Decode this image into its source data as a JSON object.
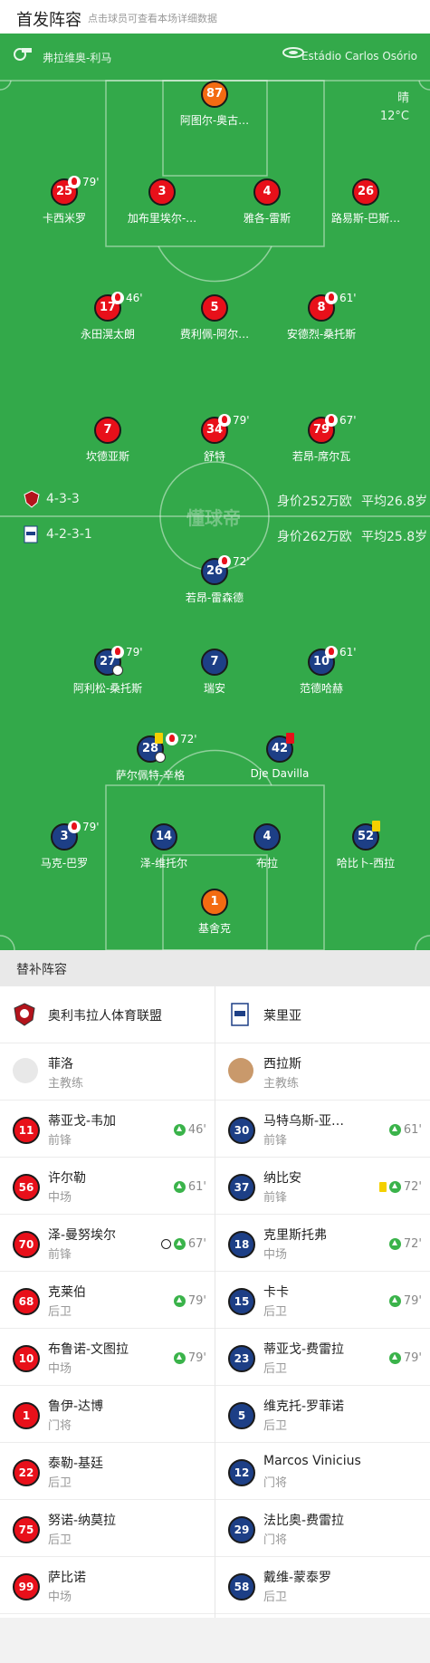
{
  "header": {
    "title": "首发阵容",
    "subtitle": "点击球员可查看本场详细数据"
  },
  "pitch": {
    "referee": "弗拉维奥-利马",
    "stadium": "Estádio Carlos Osório",
    "weather": "晴",
    "temperature": "12°C",
    "brand": "懂球帝",
    "home": {
      "formation": "4-3-3",
      "value": "身价252万欧",
      "age": "平均26.8岁"
    },
    "away": {
      "formation": "4-2-3-1",
      "value": "身价262万欧",
      "age": "平均25.8岁"
    },
    "home_players": [
      {
        "num": "87",
        "name": "阿图尔-奥古…",
        "color": "#f36b12",
        "events": []
      },
      {
        "num": "25",
        "name": "卡西米罗",
        "color": "#e8101a",
        "events": [
          "sub_out"
        ],
        "minute": "79'"
      },
      {
        "num": "3",
        "name": "加布里埃尔-…",
        "color": "#e8101a",
        "events": []
      },
      {
        "num": "4",
        "name": "雅各-雷斯",
        "color": "#e8101a",
        "events": []
      },
      {
        "num": "26",
        "name": "路易斯-巴斯…",
        "color": "#e8101a",
        "events": []
      },
      {
        "num": "17",
        "name": "永田滉太朗",
        "color": "#e8101a",
        "events": [
          "sub_out"
        ],
        "minute": "46'"
      },
      {
        "num": "5",
        "name": "费利佩-阿尔…",
        "color": "#e8101a",
        "events": []
      },
      {
        "num": "8",
        "name": "安德烈-桑托斯",
        "color": "#e8101a",
        "events": [
          "sub_out"
        ],
        "minute": "61'"
      },
      {
        "num": "7",
        "name": "坎德亚斯",
        "color": "#e8101a",
        "events": []
      },
      {
        "num": "34",
        "name": "舒特",
        "color": "#e8101a",
        "events": [
          "sub_out"
        ],
        "minute": "79'"
      },
      {
        "num": "79",
        "name": "若昂-席尔瓦",
        "color": "#e8101a",
        "events": [
          "sub_out"
        ],
        "minute": "67'"
      }
    ],
    "away_players": [
      {
        "num": "26",
        "name": "若昂-雷森德",
        "color": "#1d3f86",
        "events": [
          "sub_out"
        ],
        "minute": "72'"
      },
      {
        "num": "27",
        "name": "阿利松-桑托斯",
        "color": "#1d3f86",
        "events": [
          "sub_out",
          "goal"
        ],
        "minute": "79'"
      },
      {
        "num": "7",
        "name": "瑞安",
        "color": "#1d3f86",
        "events": []
      },
      {
        "num": "10",
        "name": "范德哈赫",
        "color": "#1d3f86",
        "events": [
          "sub_out"
        ],
        "minute": "61'"
      },
      {
        "num": "28",
        "name": "萨尔佩特-辛格",
        "color": "#1d3f86",
        "events": [
          "yellow",
          "sub_out",
          "goal"
        ],
        "minute": "72'"
      },
      {
        "num": "42",
        "name": "Dje Davilla",
        "color": "#1d3f86",
        "events": [
          "red"
        ]
      },
      {
        "num": "3",
        "name": "马克-巴罗",
        "color": "#1d3f86",
        "events": [
          "sub_out"
        ],
        "minute": "79'"
      },
      {
        "num": "14",
        "name": "泽-维托尔",
        "color": "#1d3f86",
        "events": []
      },
      {
        "num": "4",
        "name": "布拉",
        "color": "#1d3f86",
        "events": []
      },
      {
        "num": "52",
        "name": "哈比卜-西拉",
        "color": "#1d3f86",
        "events": [
          "yellow"
        ]
      },
      {
        "num": "1",
        "name": "基舍克",
        "color": "#f36b12",
        "events": []
      }
    ]
  },
  "subs": {
    "title": "替补阵容",
    "home": {
      "team": "奥利韦拉人体育联盟",
      "coach": {
        "name": "菲洛",
        "role": "主教练"
      },
      "players": [
        {
          "num": "11",
          "name": "蒂亚戈-韦加",
          "pos": "前锋",
          "minute": "46'",
          "sub_in": true
        },
        {
          "num": "56",
          "name": "许尔勒",
          "pos": "中场",
          "minute": "61'",
          "sub_in": true
        },
        {
          "num": "70",
          "name": "泽-曼努埃尔",
          "pos": "前锋",
          "minute": "67'",
          "sub_in": true,
          "goal": true
        },
        {
          "num": "68",
          "name": "克莱伯",
          "pos": "后卫",
          "minute": "79'",
          "sub_in": true
        },
        {
          "num": "10",
          "name": "布鲁诺-文图拉",
          "pos": "中场",
          "minute": "79'",
          "sub_in": true
        },
        {
          "num": "1",
          "name": "鲁伊-达博",
          "pos": "门将"
        },
        {
          "num": "22",
          "name": "泰勒-基廷",
          "pos": "后卫"
        },
        {
          "num": "75",
          "name": "努诺-纳莫拉",
          "pos": "后卫"
        },
        {
          "num": "99",
          "name": "萨比诺",
          "pos": "中场"
        }
      ]
    },
    "away": {
      "team": "莱里亚",
      "coach": {
        "name": "西拉斯",
        "role": "主教练"
      },
      "players": [
        {
          "num": "30",
          "name": "马特乌斯-亚…",
          "pos": "前锋",
          "minute": "61'",
          "sub_in": true
        },
        {
          "num": "37",
          "name": "纳比安",
          "pos": "前锋",
          "minute": "72'",
          "sub_in": true,
          "yellow": true
        },
        {
          "num": "18",
          "name": "克里斯托弗",
          "pos": "中场",
          "minute": "72'",
          "sub_in": true
        },
        {
          "num": "15",
          "name": "卡卡",
          "pos": "后卫",
          "minute": "79'",
          "sub_in": true
        },
        {
          "num": "23",
          "name": "蒂亚戈-费雷拉",
          "pos": "后卫",
          "minute": "79'",
          "sub_in": true
        },
        {
          "num": "5",
          "name": "维克托-罗菲诺",
          "pos": "后卫"
        },
        {
          "num": "12",
          "name": "Marcos Vinicius",
          "pos": "门将"
        },
        {
          "num": "29",
          "name": "法比奥-费雷拉",
          "pos": "门将"
        },
        {
          "num": "58",
          "name": "戴维-蒙泰罗",
          "pos": "后卫"
        }
      ]
    }
  }
}
